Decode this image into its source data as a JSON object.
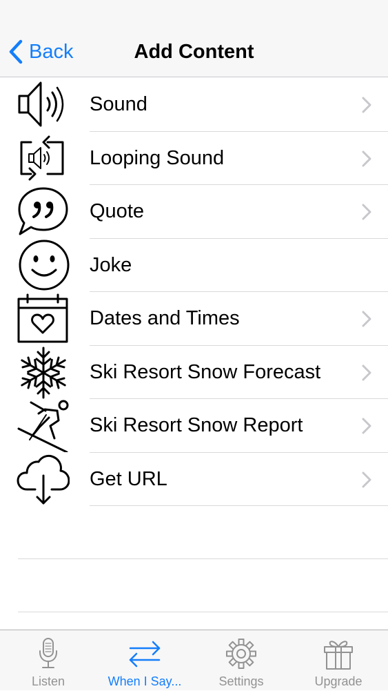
{
  "nav": {
    "back_label": "Back",
    "title": "Add Content"
  },
  "items": [
    {
      "label": "Sound",
      "icon": "speaker-icon",
      "has_chevron": true
    },
    {
      "label": "Looping Sound",
      "icon": "loop-speaker-icon",
      "has_chevron": true
    },
    {
      "label": "Quote",
      "icon": "quote-bubble-icon",
      "has_chevron": true
    },
    {
      "label": "Joke",
      "icon": "smiley-icon",
      "has_chevron": false
    },
    {
      "label": "Dates and Times",
      "icon": "calendar-heart-icon",
      "has_chevron": true
    },
    {
      "label": "Ski Resort Snow Forecast",
      "icon": "snowflake-icon",
      "has_chevron": true
    },
    {
      "label": "Ski Resort Snow Report",
      "icon": "skier-icon",
      "has_chevron": true
    },
    {
      "label": "Get URL",
      "icon": "cloud-download-icon",
      "has_chevron": true
    }
  ],
  "tabs": [
    {
      "label": "Listen",
      "icon": "microphone-icon",
      "active": false
    },
    {
      "label": "When I Say...",
      "icon": "swap-arrows-icon",
      "active": true
    },
    {
      "label": "Settings",
      "icon": "gear-icon",
      "active": false
    },
    {
      "label": "Upgrade",
      "icon": "gift-icon",
      "active": false
    }
  ],
  "colors": {
    "accent": "#147efb",
    "inactive": "#929292",
    "separator": "#d9d9d9",
    "bar_bg": "#f7f7f7"
  }
}
